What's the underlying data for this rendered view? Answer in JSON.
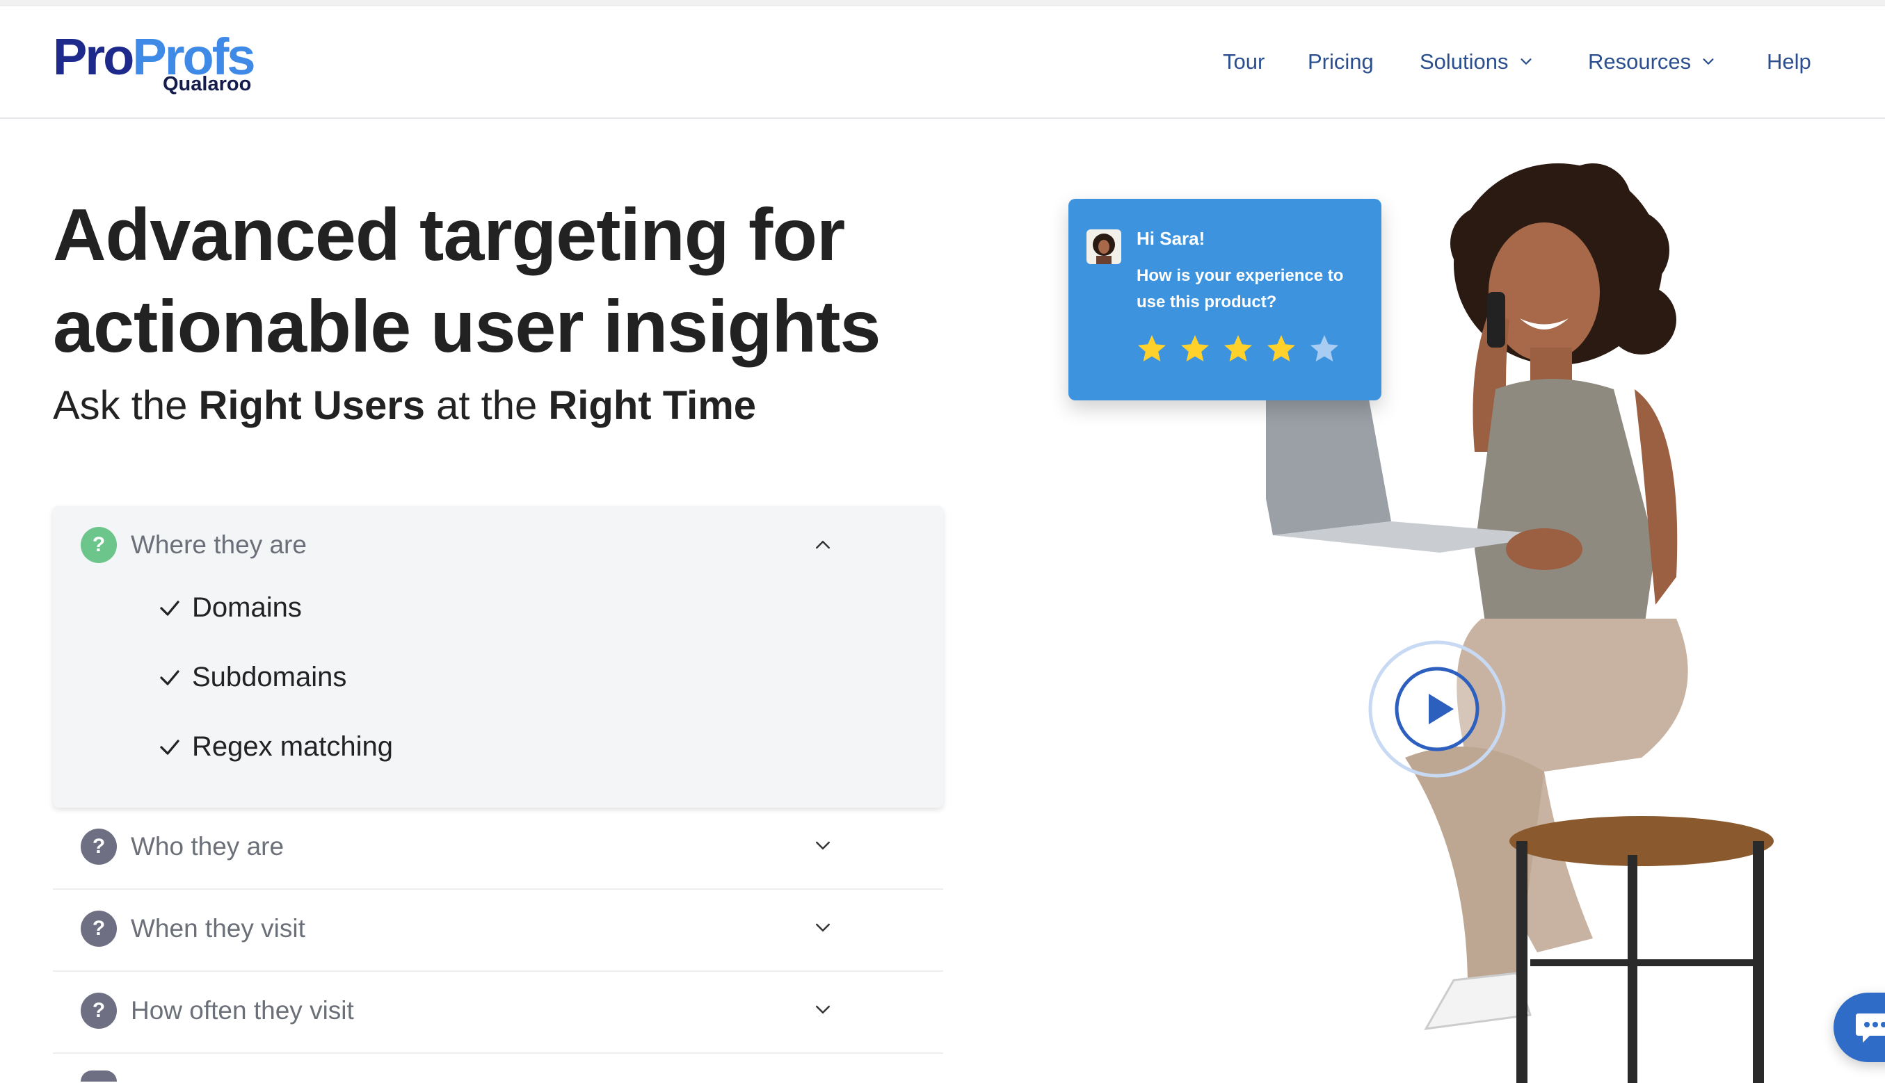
{
  "brand": {
    "logo_pro": "Pro",
    "logo_profs": "Profs",
    "logo_sub": "Qualaroo",
    "colors": {
      "pro": "#1d2a8c",
      "profs": "#3f8ae6",
      "nav": "#2b4f8e"
    }
  },
  "nav": {
    "items": [
      {
        "label": "Tour",
        "has_dropdown": false
      },
      {
        "label": "Pricing",
        "has_dropdown": false
      },
      {
        "label": "Solutions",
        "has_dropdown": true
      },
      {
        "label": "Resources",
        "has_dropdown": true
      },
      {
        "label": "Help",
        "has_dropdown": false
      }
    ]
  },
  "hero": {
    "title_line1": "Advanced targeting for",
    "title_line2": "actionable user insights",
    "sub_prefix": "Ask the ",
    "sub_bold1": "Right Users",
    "sub_mid": " at the ",
    "sub_bold2": "Right Time"
  },
  "accordion": {
    "open_item": {
      "label": "Where they are",
      "icon": "question-circle-icon",
      "icon_color": "#6cc58b",
      "checks": [
        "Domains",
        "Subdomains",
        "Regex matching"
      ]
    },
    "collapsed_items": [
      {
        "label": "Who they are"
      },
      {
        "label": "When they visit"
      },
      {
        "label": "How often they visit"
      }
    ],
    "collapsed_icon_color": "#6f6f83"
  },
  "survey_card": {
    "greeting": "Hi Sara!",
    "question": "How is your experience to use this product?",
    "rating": 4,
    "max_rating": 5,
    "card_color": "#3e93de"
  }
}
